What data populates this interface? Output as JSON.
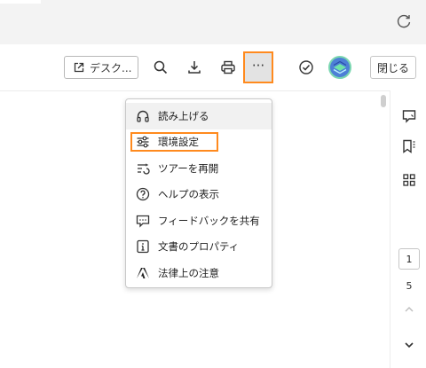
{
  "toolbar": {
    "desktop_label": "デスク...",
    "close_label": "閉じる",
    "more_label": "···"
  },
  "menu": {
    "items": [
      {
        "label": "読み上げる",
        "icon": "headphones-icon"
      },
      {
        "label": "環境設定",
        "icon": "sliders-icon"
      },
      {
        "label": "ツアーを再開",
        "icon": "tour-icon"
      },
      {
        "label": "ヘルプの表示",
        "icon": "help-icon"
      },
      {
        "label": "フィードバックを共有",
        "icon": "feedback-icon"
      },
      {
        "label": "文書のプロパティ",
        "icon": "info-icon"
      },
      {
        "label": "法律上の注意",
        "icon": "adobe-icon"
      }
    ]
  },
  "pagination": {
    "current": "1",
    "total": "5"
  },
  "colors": {
    "highlight": "#ff8a1e",
    "topbar_bg": "#f3f3f3",
    "more_button_bg": "#e3e3e3"
  }
}
